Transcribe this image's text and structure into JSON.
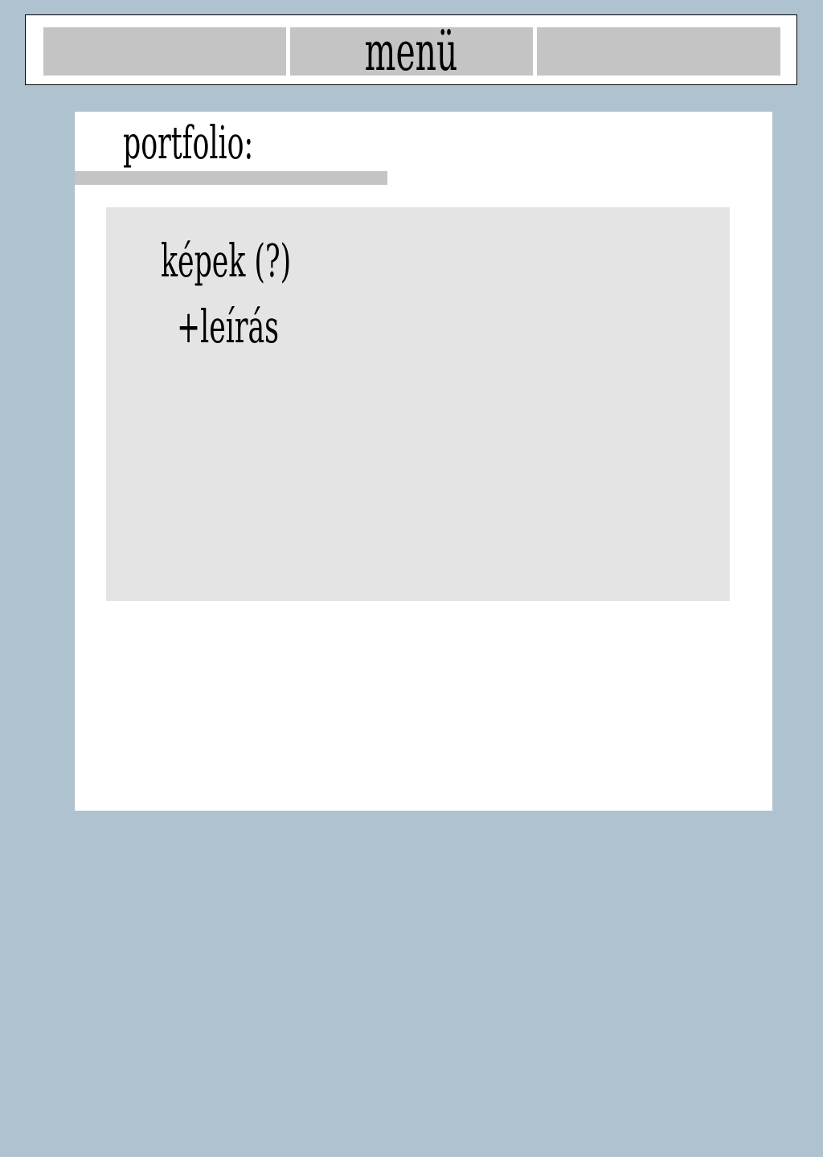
{
  "menu": {
    "title": "menü"
  },
  "portfolio": {
    "heading": "portfolio:",
    "content": {
      "line1": "képek (?)",
      "line2": "+leírás"
    }
  },
  "colors": {
    "background": "#aec2d0",
    "panel": "#ffffff",
    "menu_button": "#c4c4c4",
    "image_box": "#e4e4e4"
  }
}
